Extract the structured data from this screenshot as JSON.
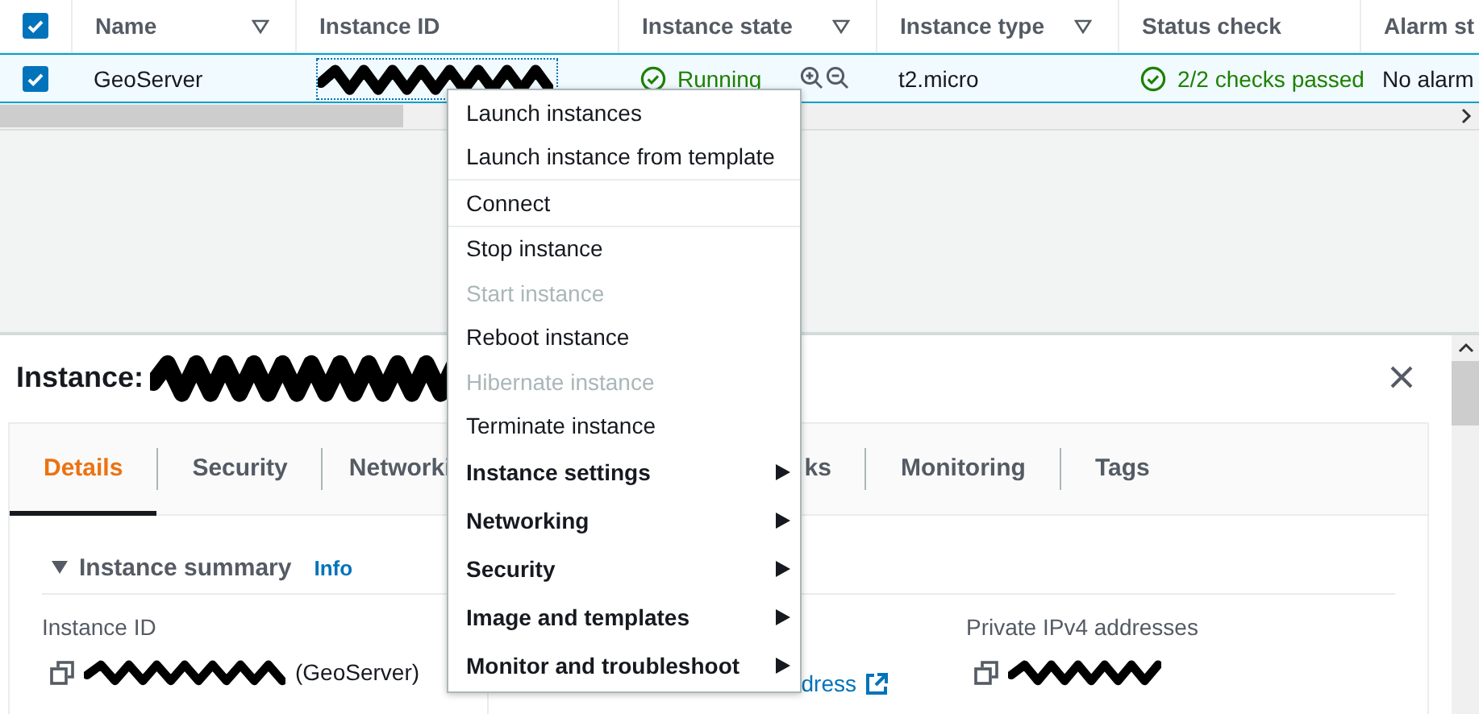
{
  "table": {
    "select_all": {
      "checked": true
    },
    "columns": [
      {
        "label": "Name",
        "filterable": true
      },
      {
        "label": "Instance ID",
        "filterable": false
      },
      {
        "label": "Instance state",
        "filterable": true
      },
      {
        "label": "Instance type",
        "filterable": true
      },
      {
        "label": "Status check",
        "filterable": false
      },
      {
        "label": "Alarm st"
      }
    ],
    "rows": [
      {
        "selected": true,
        "name": "GeoServer",
        "instance_state": "Running",
        "instance_type": "t2.micro",
        "status_check": "2/2 checks passed",
        "alarm_status": "No alarm"
      }
    ]
  },
  "details": {
    "title": "Instance:",
    "tabs": [
      {
        "label": "Details",
        "selected": true
      },
      {
        "label": "Security",
        "selected": false
      },
      {
        "label": "Networki",
        "selected": false
      },
      {
        "label": "ks",
        "selected": false
      },
      {
        "label": "Monitoring",
        "selected": false
      },
      {
        "label": "Tags",
        "selected": false
      }
    ],
    "summary": {
      "title": "Instance summary",
      "info_link": "Info",
      "expanded": true,
      "fields": [
        {
          "kind": "copy",
          "label": "Instance ID",
          "value": "(GeoServer)"
        },
        {
          "kind": "link",
          "value": "dress"
        },
        {
          "kind": "copy",
          "label": "Private IPv4 addresses"
        }
      ]
    }
  },
  "context_menu": {
    "groups": [
      [
        {
          "kind": "action",
          "label": "Launch instances",
          "disabled": false
        },
        {
          "kind": "action",
          "label": "Launch instance from template",
          "disabled": false
        }
      ],
      [
        {
          "kind": "action",
          "label": "Connect",
          "disabled": false
        }
      ],
      [
        {
          "kind": "action",
          "label": "Stop instance",
          "disabled": false
        },
        {
          "kind": "action",
          "label": "Start instance",
          "disabled": true
        },
        {
          "kind": "action",
          "label": "Reboot instance",
          "disabled": false
        },
        {
          "kind": "action",
          "label": "Hibernate instance",
          "disabled": true
        },
        {
          "kind": "action",
          "label": "Terminate instance",
          "disabled": false
        },
        {
          "kind": "submenu",
          "label": "Instance settings",
          "disabled": false
        },
        {
          "kind": "submenu",
          "label": "Networking",
          "disabled": false
        },
        {
          "kind": "submenu",
          "label": "Security",
          "disabled": false
        },
        {
          "kind": "submenu",
          "label": "Image and templates",
          "disabled": false
        },
        {
          "kind": "submenu",
          "label": "Monitor and troubleshoot",
          "disabled": false
        }
      ]
    ]
  }
}
